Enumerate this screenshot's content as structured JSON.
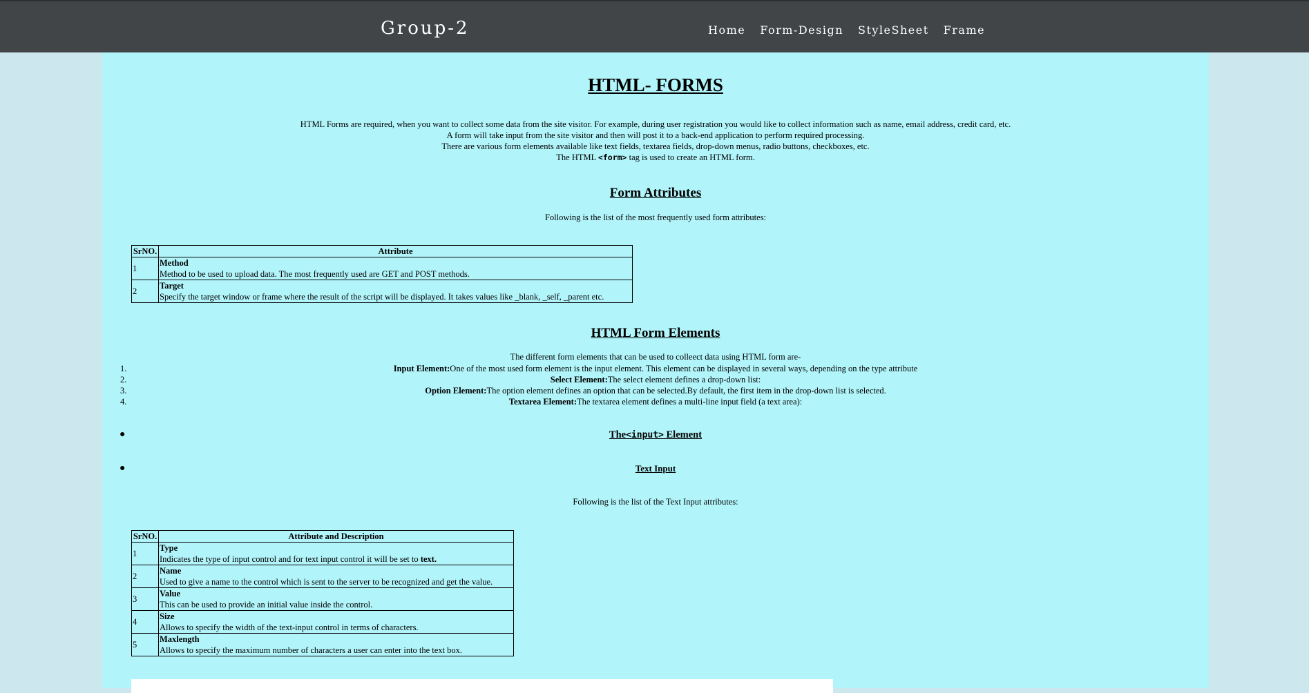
{
  "nav": {
    "brand": "Group-2",
    "links": [
      "Home",
      "Form-Design",
      "StyleSheet",
      "Frame"
    ]
  },
  "title": "HTML- FORMS",
  "intro": {
    "line1": "HTML Forms are required, when you want to collect some data from the site visitor. For example, during user registration you would like to collect information such as name, email address, credit card, etc.",
    "line2": "A form will take input from the site visitor and then will post it to a back-end application to perform required processing.",
    "line3": "There are various form elements available like text fields, textarea fields, drop-down menus, radio buttons, checkboxes, etc.",
    "line4_pre": "The HTML ",
    "line4_code": "<form>",
    "line4_post": " tag is used to create an HTML form."
  },
  "form_attributes": {
    "heading": "Form Attributes",
    "intro": "Following is the list of the most frequently used form attributes:",
    "col_srno": "SrNO.",
    "col_attr": "Attribute",
    "rows": [
      {
        "num": "1",
        "name": "Method",
        "desc": "Method to be used to upload data. The most frequently used are GET and POST methods."
      },
      {
        "num": "2",
        "name": "Target",
        "desc": "Specify the target window or frame where the result of the script will be displayed. It takes values like _blank, _self, _parent etc."
      }
    ]
  },
  "form_elements": {
    "heading": "HTML Form Elements",
    "intro": "The different form elements that can be used to colleect data using HTML form are-",
    "items": [
      {
        "num": "1.",
        "bold": "Input Element:",
        "text": "One of the most used form element is the input element. This element can be displayed in several ways, depending on the type attribute"
      },
      {
        "num": "2.",
        "bold": "Select Element:",
        "text": "The select element defines a drop-down list:"
      },
      {
        "num": "3.",
        "bold": "Option Element:",
        "text": "The option element defines an option that can be selected.By default, the first item in the drop-down list is selected."
      },
      {
        "num": "4.",
        "bold": "Textarea Element:",
        "text": "The textarea element defines a multi-line input field (a text area):"
      }
    ]
  },
  "input_element": {
    "heading_pre": "The",
    "heading_code": "<input>",
    "heading_post": " Element",
    "subheading": "Text Input",
    "intro": "Following is the list of the Text Input attributes:",
    "col_srno": "SrNO.",
    "col_attr": "Attribute and Description",
    "rows": [
      {
        "num": "1",
        "name": "Type",
        "desc": "Indicates the type of input control and for text input control it will be set to ",
        "desc_bold": "text."
      },
      {
        "num": "2",
        "name": "Name",
        "desc": "Used to give a name to the control which is sent to the server to be recognized and get the value.",
        "desc_bold": ""
      },
      {
        "num": "3",
        "name": "Value",
        "desc": "This can be used to provide an initial value inside the control.",
        "desc_bold": ""
      },
      {
        "num": "4",
        "name": "Size",
        "desc": "Allows to specify the width of the text-input control in terms of characters.",
        "desc_bold": ""
      },
      {
        "num": "5",
        "name": "Maxlength",
        "desc": "Allows to specify the maximum number of characters a user can enter into the text box.",
        "desc_bold": ""
      }
    ]
  }
}
